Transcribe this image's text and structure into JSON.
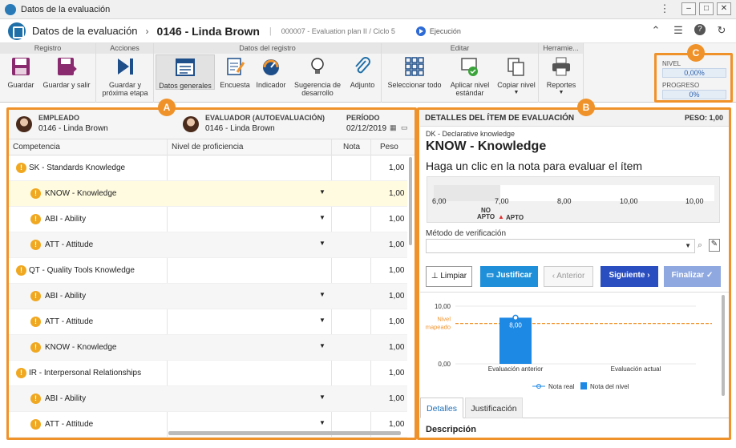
{
  "window": {
    "title": "Datos de la evaluación"
  },
  "header": {
    "breadcrumb_root": "Datos de la evaluación",
    "breadcrumb_current": "0146 - Linda Brown",
    "plan": "000007 - Evaluation plan II / Ciclo 5",
    "status": "Ejecución"
  },
  "ribbon": {
    "groups": {
      "registro": "Registro",
      "acciones": "Acciones",
      "datos": "Datos del registro",
      "editar": "Editar",
      "herramientas": "Herramie..."
    },
    "buttons": {
      "guardar": "Guardar",
      "guardar_salir": "Guardar y salir",
      "guardar_proxima_1": "Guardar y",
      "guardar_proxima_2": "próxima etapa",
      "datos_generales": "Datos generales",
      "encuesta": "Encuesta",
      "indicador": "Indicador",
      "sugerencia_1": "Sugerencia de",
      "sugerencia_2": "desarrollo",
      "adjunto": "Adjunto",
      "seleccionar_todo": "Seleccionar todo",
      "aplicar_1": "Aplicar nivel",
      "aplicar_2": "estándar",
      "copiar": "Copiar nivel",
      "reportes": "Reportes"
    }
  },
  "summary": {
    "nivel_label": "NIVEL",
    "nivel_value": "0,00%",
    "progreso_label": "PROGRESO",
    "progreso_value": "0%"
  },
  "badges": {
    "a": "A",
    "b": "B",
    "c": "C"
  },
  "left": {
    "empleado_label": "EMPLEADO",
    "empleado_value": "0146 - Linda Brown",
    "evaluador_label": "EVALUADOR (AUTOEVALUACIÓN)",
    "evaluador_value": "0146 - Linda Brown",
    "periodo_label": "PERÍODO",
    "periodo_value": "02/12/2019",
    "columns": {
      "competencia": "Competencia",
      "nivel": "Nivel de proficiencia",
      "nota": "Nota",
      "peso": "Peso"
    },
    "rows": [
      {
        "name": "SK - Standards Knowledge",
        "peso": "1,00"
      },
      {
        "name": "KNOW - Knowledge",
        "peso": "1,00"
      },
      {
        "name": "ABI - Ability",
        "peso": "1,00"
      },
      {
        "name": "ATT - Attitude",
        "peso": "1,00"
      },
      {
        "name": "QT - Quality Tools Knowledge",
        "peso": "1,00"
      },
      {
        "name": "ABI - Ability",
        "peso": "1,00"
      },
      {
        "name": "ATT - Attitude",
        "peso": "1,00"
      },
      {
        "name": "KNOW - Knowledge",
        "peso": "1,00"
      },
      {
        "name": "IR - Interpersonal Relationships",
        "peso": "1,00"
      },
      {
        "name": "ABI - Ability",
        "peso": "1,00"
      },
      {
        "name": "ATT - Attitude",
        "peso": "1,00"
      }
    ]
  },
  "right": {
    "title": "DETALLES DEL ÍTEM DE EVALUACIÓN",
    "peso": "PESO: 1,00",
    "subtitle": "DK - Declarative knowledge",
    "item": "KNOW - Knowledge",
    "instruction": "Haga un clic en la nota para evaluar el ítem",
    "scale": [
      "6,00",
      "7,00",
      "8,00",
      "10,00",
      "10,00"
    ],
    "no_apto_1": "NO",
    "no_apto_2": "APTO",
    "apto": "APTO",
    "metodo": "Método de verificación",
    "btn_limpiar": "Limpiar",
    "btn_justificar": "Justificar",
    "btn_anterior": "Anterior",
    "btn_siguiente": "Siguiente",
    "btn_finalizar": "Finalizar",
    "tab_detalles": "Detalles",
    "tab_justificacion": "Justificación",
    "descripcion": "Descripción"
  },
  "chart_data": {
    "type": "bar",
    "categories": [
      "Evaluación anterior",
      "Evaluación actual"
    ],
    "series": [
      {
        "name": "Nota real",
        "values": [
          8.0,
          null
        ]
      }
    ],
    "bar_labels": [
      "8,00",
      ""
    ],
    "ylim": [
      0,
      10
    ],
    "yticks": [
      "0,00",
      "10,00"
    ],
    "reference_line": {
      "label_1": "Nivel",
      "label_2": "mapeado",
      "value": 7.0
    },
    "legend": [
      "Nota real",
      "Nota del nivel"
    ],
    "colors": {
      "bar": "#1e88e5",
      "reference": "#f0922a"
    }
  }
}
